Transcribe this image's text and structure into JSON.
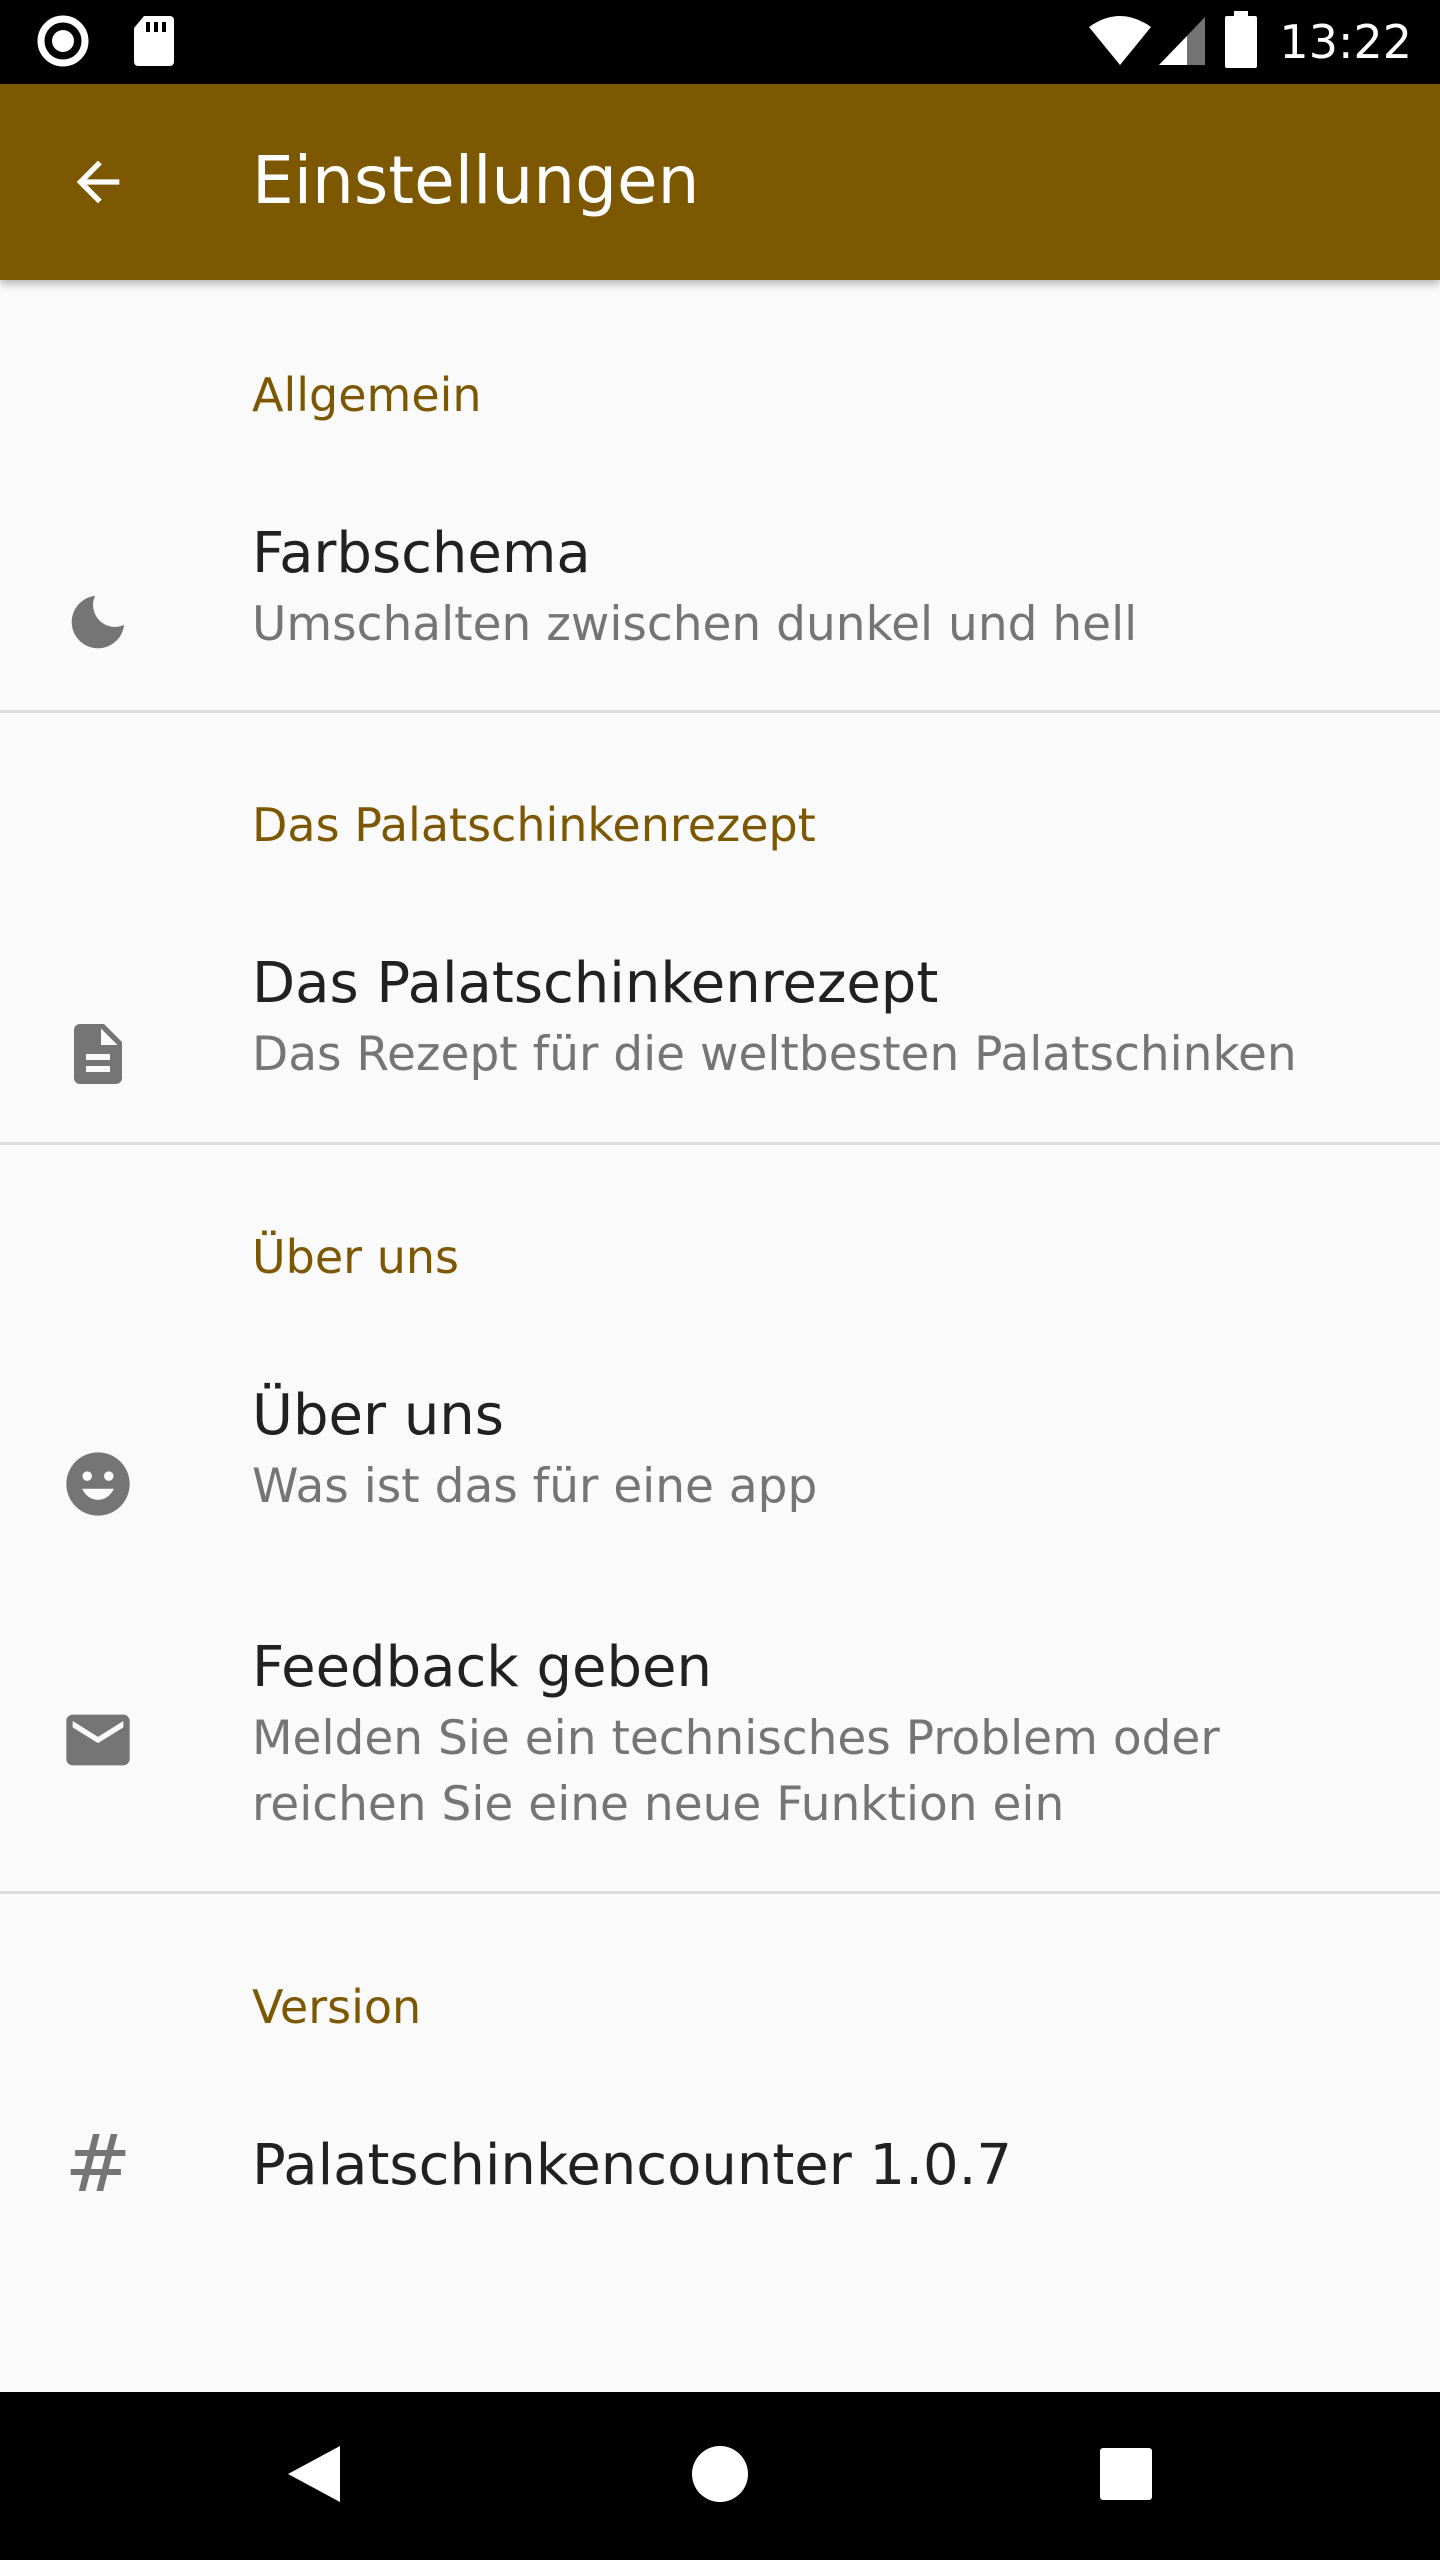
{
  "status_bar": {
    "time": "13:22",
    "icons": [
      "record-icon",
      "sd-card-icon",
      "wifi-icon",
      "signal-icon",
      "battery-icon"
    ]
  },
  "app_bar": {
    "title": "Einstellungen",
    "back_icon": "arrow-back-icon",
    "background_color": "#7d5802"
  },
  "sections": [
    {
      "header": "Allgemein",
      "items": [
        {
          "icon": "moon-icon",
          "title": "Farbschema",
          "summary": "Umschalten zwischen dunkel und hell"
        }
      ]
    },
    {
      "header": "Das Palatschinkenrezept",
      "items": [
        {
          "icon": "document-icon",
          "title": "Das Palatschinkenrezept",
          "summary": "Das Rezept für die weltbesten Palatschinken"
        }
      ]
    },
    {
      "header": "Über uns",
      "items": [
        {
          "icon": "smiley-icon",
          "title": "Über uns",
          "summary": "Was ist das für eine app"
        },
        {
          "icon": "mail-icon",
          "title": "Feedback geben",
          "summary": "Melden Sie ein technisches Problem oder reichen Sie eine neue Funktion ein"
        }
      ]
    },
    {
      "header": "Version",
      "items": [
        {
          "icon": "hash-icon",
          "icon_glyph": "#",
          "title": "Palatschinkencounter 1.0.7"
        }
      ]
    }
  ],
  "nav_bar": {
    "icons": [
      "nav-back-icon",
      "nav-home-icon",
      "nav-recents-icon"
    ]
  },
  "colors": {
    "accent": "#7d5802",
    "background": "#fafafa",
    "primary_text": "#212121",
    "secondary_text": "#757575",
    "divider": "#dcdcdc"
  }
}
